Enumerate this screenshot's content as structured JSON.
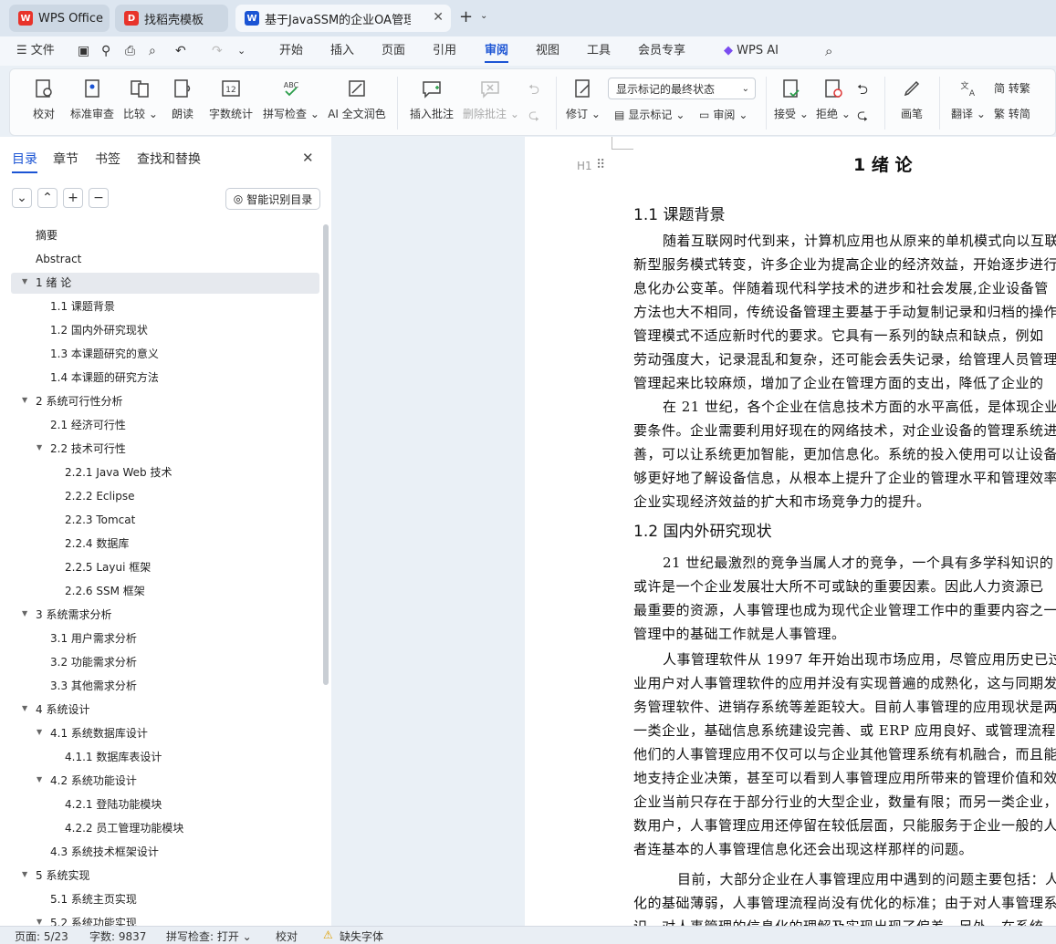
{
  "tabs": [
    {
      "label": "WPS Office",
      "icon": "wps-logo-icon",
      "color": "#e8332a"
    },
    {
      "label": "找稻壳模板",
      "icon": "docer-icon",
      "color": "#e8332a"
    },
    {
      "label": "基于JavaSSM的企业OA管理",
      "icon": "word-doc-icon",
      "color": "#1b54d4"
    }
  ],
  "menu": {
    "file": "文件",
    "items": [
      "开始",
      "插入",
      "页面",
      "引用",
      "审阅",
      "视图",
      "工具",
      "会员专享"
    ],
    "active": "审阅",
    "ai": "WPS AI"
  },
  "ribbon": {
    "proofread": "校对",
    "std_review": "标准审查",
    "compare": "比较",
    "read_aloud": "朗读",
    "word_count": "字数统计",
    "spell_check": "拼写检查",
    "ai_polish": "AI 全文润色",
    "insert_comment": "插入批注",
    "delete_comment": "删除批注",
    "track_changes": "修订",
    "display_select": "显示标记的最终状态",
    "show_markup": "显示标记",
    "review": "审阅",
    "accept": "接受",
    "reject": "拒绝",
    "pen": "画笔",
    "translate": "翻译",
    "to_traditional": "简 转繁",
    "to_simplified": "繁 转简"
  },
  "sidebar": {
    "tabs": [
      "目录",
      "章节",
      "书签",
      "查找和替换"
    ],
    "smart_btn": "智能识别目录",
    "toc": [
      {
        "label": "摘要",
        "level": 0
      },
      {
        "label": "Abstract",
        "level": 0
      },
      {
        "label": "1  绪  论",
        "level": 0
      },
      {
        "label": "1.1  课题背景",
        "level": 1
      },
      {
        "label": "1.2  国内外研究现状",
        "level": 1
      },
      {
        "label": "1.3  本课题研究的意义",
        "level": 1
      },
      {
        "label": "1.4  本课题的研究方法",
        "level": 1
      },
      {
        "label": "2  系统可行性分析",
        "level": 0
      },
      {
        "label": "2.1  经济可行性",
        "level": 1
      },
      {
        "label": "2.2  技术可行性",
        "level": 1
      },
      {
        "label": "2.2.1 Java Web 技术",
        "level": 2
      },
      {
        "label": "2.2.2 Eclipse",
        "level": 2
      },
      {
        "label": "2.2.3 Tomcat",
        "level": 2
      },
      {
        "label": "2.2.4  数据库",
        "level": 2
      },
      {
        "label": "2.2.5 Layui 框架",
        "level": 2
      },
      {
        "label": "2.2.6 SSM 框架",
        "level": 2
      },
      {
        "label": "3  系统需求分析",
        "level": 0
      },
      {
        "label": "3.1  用户需求分析",
        "level": 1
      },
      {
        "label": "3.2  功能需求分析",
        "level": 1
      },
      {
        "label": "3.3  其他需求分析",
        "level": 1
      },
      {
        "label": "4  系统设计",
        "level": 0
      },
      {
        "label": "4.1  系统数据库设计",
        "level": 1
      },
      {
        "label": "4.1.1  数据库表设计",
        "level": 2
      },
      {
        "label": "4.2  系统功能设计",
        "level": 1
      },
      {
        "label": "4.2.1  登陆功能模块",
        "level": 2
      },
      {
        "label": "4.2.2  员工管理功能模块",
        "level": 2
      },
      {
        "label": "4.3  系统技术框架设计",
        "level": 1
      },
      {
        "label": "5  系统实现",
        "level": 0
      },
      {
        "label": "5.1  系统主页实现",
        "level": 1
      },
      {
        "label": "5.2  系统功能实现",
        "level": 1
      }
    ]
  },
  "document": {
    "chapter_title": "1  绪  论",
    "h_marker": "H1",
    "s1_title": "1.1  课题背景",
    "p1": [
      "随着互联网时代到来，计算机应用也从原来的单机模式向以互联",
      "新型服务模式转变，许多企业为提高企业的经济效益，开始逐步进行",
      "息化办公变革。伴随着现代科学技术的进步和社会发展,企业设备管",
      "方法也大不相同，传统设备管理主要基于手动复制记录和归档的操作",
      "管理模式不适应新时代的要求。它具有一系列的缺点和缺点，例如",
      "劳动强度大，记录混乱和复杂，还可能会丢失记录，给管理人员管理",
      "管理起来比较麻烦，增加了企业在管理方面的支出，降低了企业的"
    ],
    "p2": [
      "在 21 世纪，各个企业在信息技术方面的水平高低，是体现企业",
      "要条件。企业需要利用好现在的网络技术，对企业设备的管理系统进",
      "善，可以让系统更加智能，更加信息化。系统的投入使用可以让设备",
      "够更好地了解设备信息，从根本上提升了企业的管理水平和管理效率",
      "企业实现经济效益的扩大和市场竞争力的提升。"
    ],
    "s2_title": "1.2  国内外研究现状",
    "p3": [
      "21 世纪最激烈的竞争当属人才的竞争，一个具有多学科知识的",
      "或许是一个企业发展壮大所不可或缺的重要因素。因此人力资源已",
      "最重要的资源，人事管理也成为现代企业管理工作中的重要内容之一",
      "管理中的基础工作就是人事管理。"
    ],
    "p4": [
      "人事管理软件从 1997 年开始出现市场应用，尽管应用历史已过",
      "业用户对人事管理软件的应用并没有实现普遍的成熟化，这与同期发",
      "务管理软件、进销存系统等差距较大。目前人事管理的应用现状是两",
      "一类企业，基础信息系统建设完善、或 ERP 应用良好、或管理流程",
      "他们的人事管理应用不仅可以与企业其他管理系统有机融合，而且能",
      "地支持企业决策，甚至可以看到人事管理应用所带来的管理价值和效",
      "企业当前只存在于部分行业的大型企业，数量有限；而另一类企业，",
      "数用户，人事管理应用还停留在较低层面，只能服务于企业一般的人",
      "者连基本的人事管理信息化还会出现这样那样的问题。"
    ],
    "p5": [
      "目前，大部分企业在人事管理应用中遇到的问题主要包括：人",
      "化的基础薄弱，人事管理流程尚没有优化的标准；由于对人事管理系",
      "识，对人事管理的信息化的理解及实现出现了偏差。另外，在系统"
    ]
  },
  "status": {
    "page": "页面: 5/23",
    "words": "字数: 9837",
    "spell": "拼写检查: 打开",
    "proof": "校对",
    "missing_font": "缺失字体"
  }
}
